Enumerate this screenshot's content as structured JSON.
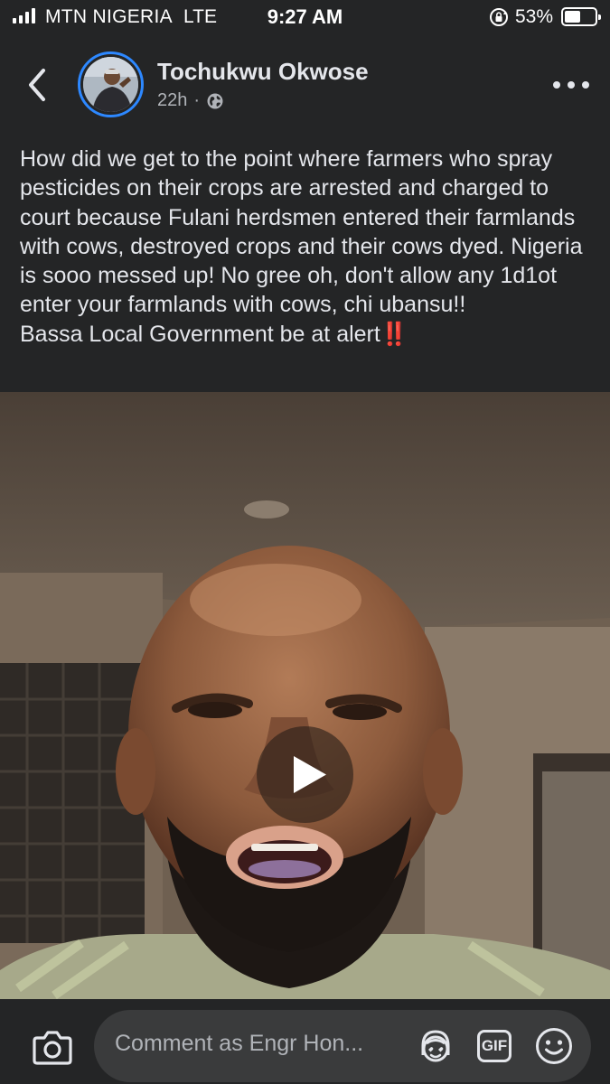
{
  "status_bar": {
    "carrier": "MTN NIGERIA",
    "network": "LTE",
    "time": "9:27 AM",
    "battery_percent": "53%",
    "battery_level": 0.53,
    "icons": [
      "signal-icon",
      "rotation-lock-icon",
      "battery-icon"
    ]
  },
  "post": {
    "author": "Tochukwu Okwose",
    "time_ago": "22h",
    "separator": "·",
    "audience_icon": "globe-icon",
    "caption_body": "How did we get to the point where farmers who spray pesticides on their crops are arrested and charged to court because Fulani herdsmen entered their farmlands with cows, destroyed crops and their cows dyed. Nigeria is sooo messed up! No gree oh, don't allow any 1d1ot enter your farmlands with cows, chi ubansu!!",
    "caption_last_line": "Bassa Local Government be at alert",
    "caption_emoji": "‼️",
    "video": {
      "play_icon": "play-icon"
    }
  },
  "comment_bar": {
    "placeholder": "Comment as Engr Hon...",
    "gif_label": "GIF",
    "icons": [
      "camera-icon",
      "avatar-sticker-icon",
      "gif-icon",
      "emoji-icon"
    ]
  },
  "colors": {
    "background": "#242526",
    "text": "#e4e6eb",
    "secondary_text": "#b0b3b8",
    "accent": "#2d88ff",
    "input_bg": "#3a3b3c",
    "alert": "#e0242b"
  }
}
